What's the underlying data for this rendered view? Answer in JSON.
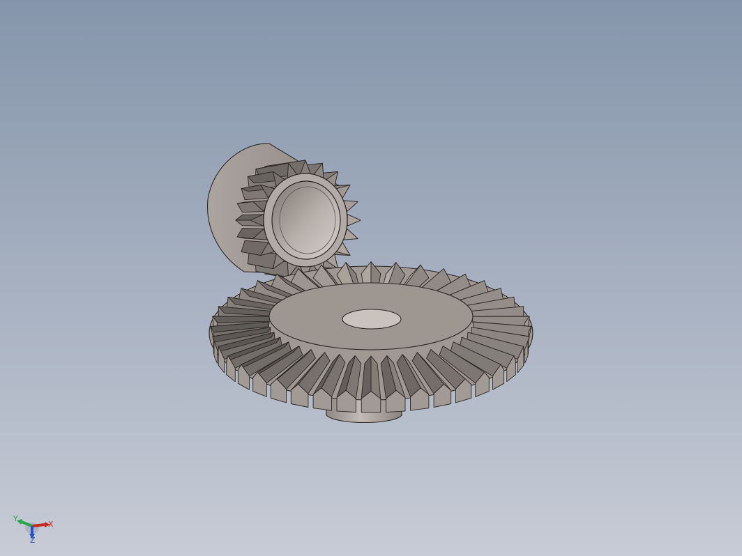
{
  "viewport": {
    "background_top": "#8595ab",
    "background_bottom": "#c7ccd6"
  },
  "model": {
    "components": [
      "pinion-bevel-gear",
      "ring-bevel-gear"
    ],
    "pinion_teeth": 20,
    "ring_teeth": 40,
    "material_color": "#a59d97",
    "edge_color": "#2a2624"
  },
  "triad": {
    "x_label": "X",
    "y_label": "Y",
    "z_label": "Z",
    "x_color": "#c42a20",
    "y_color": "#2aa64a",
    "z_color": "#2a52c6"
  }
}
